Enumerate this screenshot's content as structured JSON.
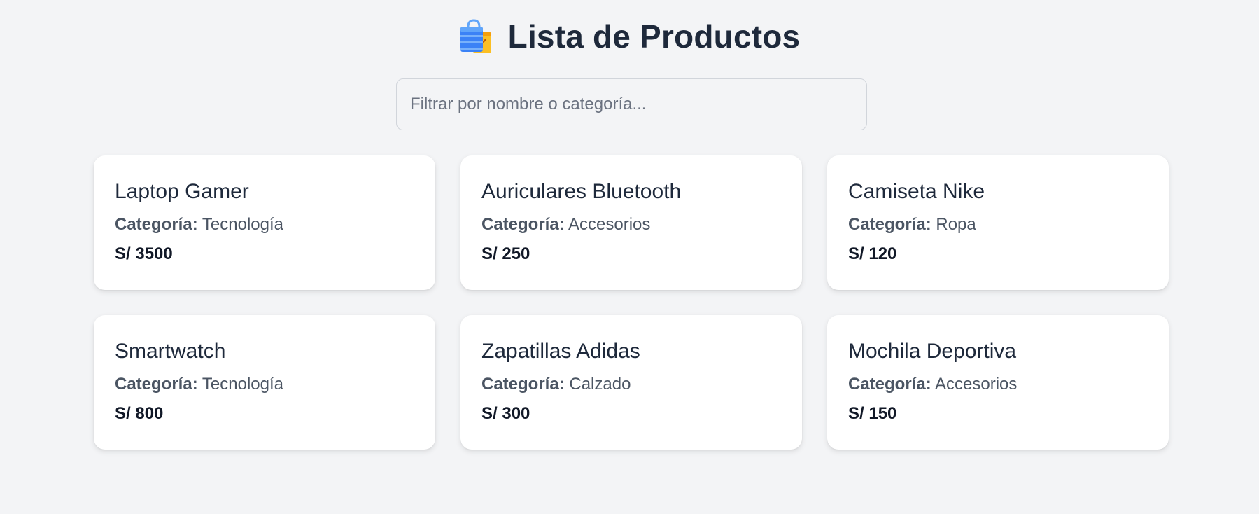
{
  "header": {
    "icon": "shopping-bags-icon",
    "title": "Lista de Productos"
  },
  "search": {
    "value": "",
    "placeholder": "Filtrar por nombre o categoría..."
  },
  "labels": {
    "category": "Categoría:"
  },
  "products": [
    {
      "name": "Laptop Gamer",
      "category": "Tecnología",
      "price": "S/ 3500"
    },
    {
      "name": "Auriculares Bluetooth",
      "category": "Accesorios",
      "price": "S/ 250"
    },
    {
      "name": "Camiseta Nike",
      "category": "Ropa",
      "price": "S/ 120"
    },
    {
      "name": "Smartwatch",
      "category": "Tecnología",
      "price": "S/ 800"
    },
    {
      "name": "Zapatillas Adidas",
      "category": "Calzado",
      "price": "S/ 300"
    },
    {
      "name": "Mochila Deportiva",
      "category": "Accesorios",
      "price": "S/ 150"
    }
  ],
  "colors": {
    "background": "#f3f4f6",
    "card": "#ffffff",
    "title": "#1e293b",
    "bag_blue": "#3b82f6",
    "bag_orange": "#f59e0b"
  }
}
